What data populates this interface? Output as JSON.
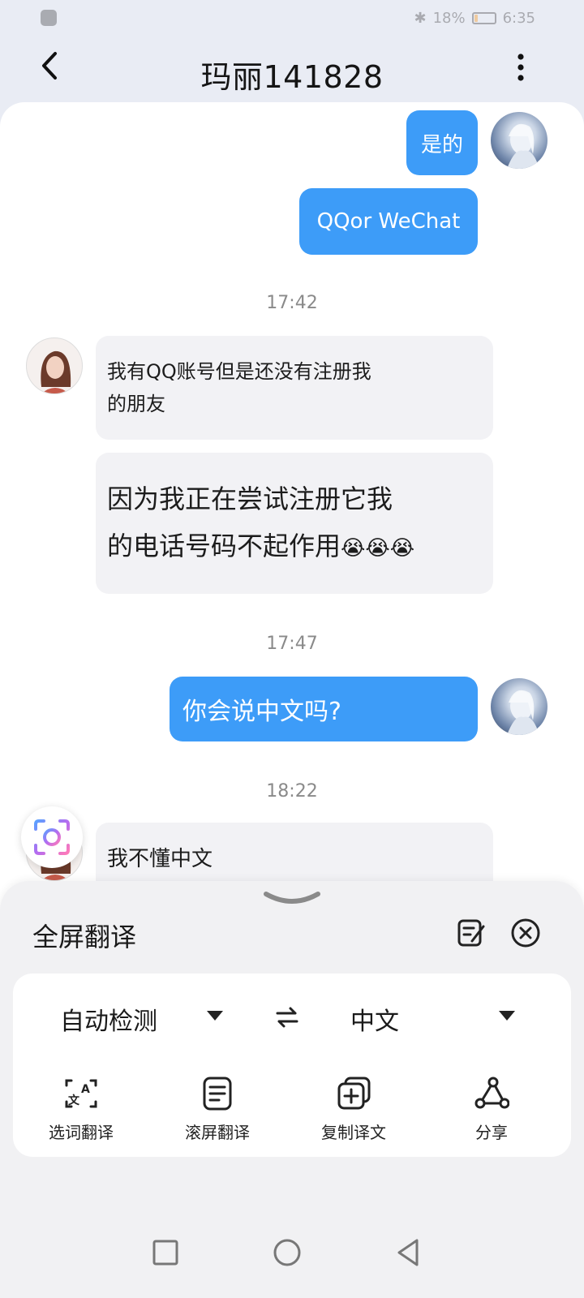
{
  "status_bar": {
    "signal": "",
    "battery_percent": "18%",
    "time": "6:35",
    "battery_level": 0.18,
    "battery_color": "#ff8c00"
  },
  "header": {
    "title": "玛丽141828",
    "back_icon": "chevron-left-icon",
    "menu_icon": "more-vertical-icon"
  },
  "messages": [
    {
      "side": "out",
      "text": "是的"
    },
    {
      "side": "out",
      "text": "QQor WeChat"
    },
    {
      "type": "time",
      "text": "17:42"
    },
    {
      "side": "in",
      "text_line1": "我有QQ账号但是还没有注册我",
      "text_line2": "的朋友"
    },
    {
      "side": "in",
      "text_line1": "因为我正在尝试注册它我",
      "text_line2": "的电话号码不起作用",
      "emoji": "😭😭😭"
    },
    {
      "type": "time",
      "text": "17:47"
    },
    {
      "side": "out",
      "text": "你会说中文吗?"
    },
    {
      "type": "time",
      "text": "18:22"
    },
    {
      "side": "in",
      "text": "我不懂中文"
    }
  ],
  "colors": {
    "outgoing_bubble": "#3d9cf8",
    "incoming_bubble": "#f2f2f5",
    "accent": "#3d9cf8"
  },
  "translate_panel": {
    "title": "全屏翻译",
    "source_language": "自动检测",
    "target_language": "中文",
    "actions": [
      {
        "label": "选词翻译",
        "icon": "word-translate-icon"
      },
      {
        "label": "滚屏翻译",
        "icon": "scroll-translate-icon"
      },
      {
        "label": "复制译文",
        "icon": "copy-translation-icon"
      },
      {
        "label": "分享",
        "icon": "share-icon"
      }
    ]
  },
  "nav": {
    "recent_icon": "square-icon",
    "home_icon": "circle-icon",
    "back_icon": "triangle-back-icon"
  }
}
